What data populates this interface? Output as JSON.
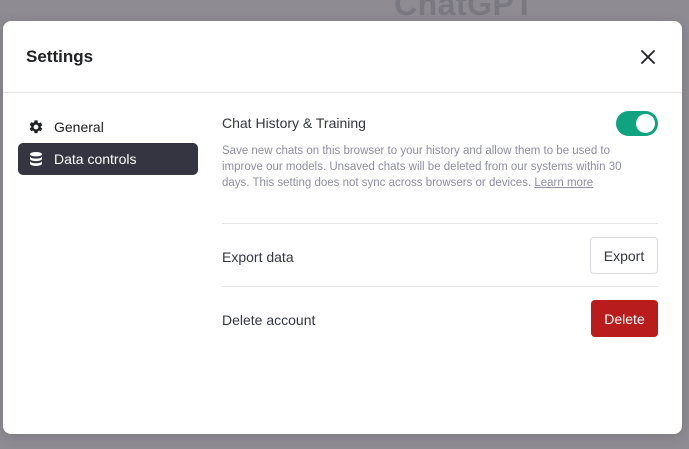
{
  "background": {
    "title": "ChatGPT"
  },
  "modal": {
    "title": "Settings",
    "close_icon": "close-icon"
  },
  "sidebar": {
    "items": [
      {
        "label": "General",
        "icon": "gear-icon",
        "active": false
      },
      {
        "label": "Data controls",
        "icon": "database-icon",
        "active": true
      }
    ]
  },
  "content": {
    "history": {
      "title": "Chat History & Training",
      "enabled": true,
      "description": "Save new chats on this browser to your history and allow them to be used to improve our models. Unsaved chats will be deleted from our systems within 30 days. This setting does not sync across browsers or devices.",
      "learn_more": "Learn more"
    },
    "export": {
      "label": "Export data",
      "button": "Export"
    },
    "delete": {
      "label": "Delete account",
      "button": "Delete"
    }
  },
  "colors": {
    "accent_green": "#10a37f",
    "danger_red": "#b91c1c",
    "sidebar_active": "#343541"
  }
}
